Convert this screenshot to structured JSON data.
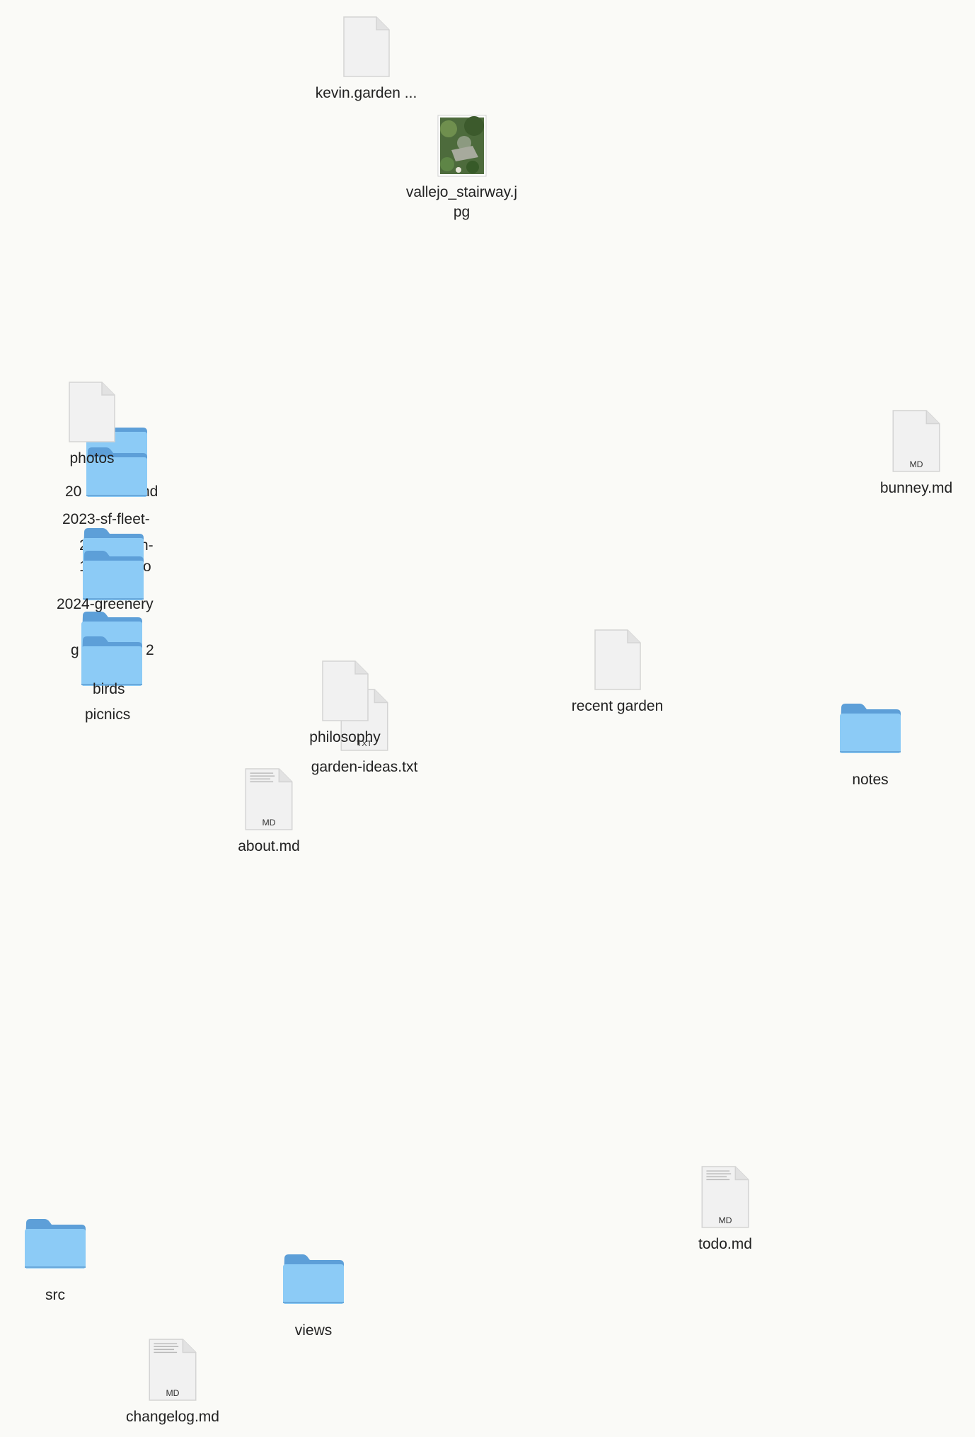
{
  "desktop": {
    "items": [
      {
        "kind": "blank",
        "label": "kevin.garden ..."
      },
      {
        "kind": "image",
        "label": "vallejo_stairway.j\npg"
      },
      {
        "kind": "folder",
        "label": "20"
      },
      {
        "kind": "folder",
        "label": "nd"
      },
      {
        "kind": "folder",
        "label": "2023-sf-fleet-"
      },
      {
        "kind": "folder",
        "label": "2"
      },
      {
        "kind": "folder",
        "label": "n-"
      },
      {
        "kind": "folder",
        "label": "1"
      },
      {
        "kind": "folder",
        "label": "o"
      },
      {
        "kind": "folder",
        "label": "2024-greenery"
      },
      {
        "kind": "folder",
        "label": "g"
      },
      {
        "kind": "folder",
        "label": "2"
      },
      {
        "kind": "folder",
        "label": "birds"
      },
      {
        "kind": "folder",
        "label": "picnics"
      },
      {
        "kind": "blank",
        "label": "photos"
      },
      {
        "kind": "md",
        "label": "bunney.md",
        "badge": "MD"
      },
      {
        "kind": "blank",
        "label": "recent garden"
      },
      {
        "kind": "txt",
        "label": "garden-ideas.txt",
        "badge": "TXT"
      },
      {
        "kind": "blank",
        "label": "philosophy"
      },
      {
        "kind": "folder",
        "label": "notes"
      },
      {
        "kind": "md",
        "label": "about.md",
        "badge": "MD"
      },
      {
        "kind": "md",
        "label": "todo.md",
        "badge": "MD"
      },
      {
        "kind": "folder",
        "label": "src"
      },
      {
        "kind": "folder",
        "label": "views"
      },
      {
        "kind": "md",
        "label": "changelog.md",
        "badge": "MD"
      }
    ]
  },
  "colors": {
    "background": "#fafaf7",
    "folder_back": "#5d9fd8",
    "folder_front": "#8ccbf6",
    "page": "#f1f1f1",
    "label": "#222222"
  },
  "icons": {
    "folder": "folder-icon",
    "blank": "blank-document-icon",
    "md": "markdown-document-icon",
    "txt": "text-document-icon",
    "image": "image-thumbnail-icon"
  }
}
